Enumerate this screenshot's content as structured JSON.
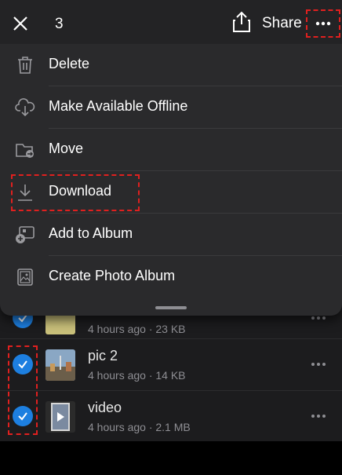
{
  "header": {
    "close_icon": "close-icon",
    "selected_count": "3",
    "share_label": "Share",
    "share_icon": "share-icon",
    "more_icon": "ellipsis-icon"
  },
  "menu": {
    "items": [
      {
        "label": "Delete",
        "icon": "trash-icon"
      },
      {
        "label": "Make Available Offline",
        "icon": "cloud-download-icon"
      },
      {
        "label": "Move",
        "icon": "folder-move-icon"
      },
      {
        "label": "Download",
        "icon": "download-icon"
      },
      {
        "label": "Add to Album",
        "icon": "add-to-album-icon"
      },
      {
        "label": "Create Photo Album",
        "icon": "photo-album-icon"
      }
    ]
  },
  "files": [
    {
      "name": "",
      "meta": "4 hours ago · 23 KB",
      "selected": true
    },
    {
      "name": "pic 2",
      "meta": "4 hours ago · 14 KB",
      "selected": true
    },
    {
      "name": "video",
      "meta": "4 hours ago · 2.1 MB",
      "selected": true
    }
  ],
  "colors": {
    "accent": "#1d7fe0",
    "highlight": "#e0201f",
    "sheet": "#2a2a2c"
  }
}
